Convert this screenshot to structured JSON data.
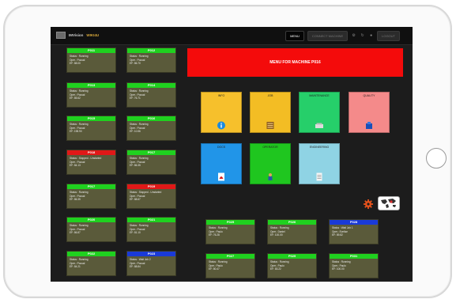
{
  "brand": {
    "name": "IMVision",
    "sub": "WIKI4U"
  },
  "nav": [
    {
      "label": "MENU",
      "active": true
    },
    {
      "label": "CONNECT MACHINE",
      "active": false
    },
    {
      "label": "LOGOUT",
      "active": false
    }
  ],
  "banner": "MENU FOR MACHINE P016",
  "machines_left": [
    {
      "name": "P011",
      "status": "Status : Running",
      "oper": "Oper.: Pousal",
      "ef": "EF: 88.00",
      "color": "green"
    },
    {
      "name": "P012",
      "status": "Status : Running",
      "oper": "Oper.: Pousal",
      "ef": "EF: 86.70",
      "color": "green"
    },
    {
      "name": "P013",
      "status": "Status : Running",
      "oper": "Oper.: Pousal",
      "ef": "EF: 85.62",
      "color": "green"
    },
    {
      "name": "P014",
      "status": "Status : Running",
      "oper": "Oper.: Pousal",
      "ef": "EF: 76.71",
      "color": "green"
    },
    {
      "name": "P015",
      "status": "Status : Running",
      "oper": "Oper.: Pousal",
      "ef": "EF: 198.90",
      "color": "green"
    },
    {
      "name": "P016",
      "status": "Status : Running",
      "oper": "Oper.: Pousal",
      "ef": "EF: 10.56",
      "color": "green"
    },
    {
      "name": "P018",
      "status": "Status : Stopped - Unstarted",
      "oper": "Oper.: Pousal",
      "ef": "EF: 84.13",
      "color": "red"
    },
    {
      "name": "P017",
      "status": "Status : Running",
      "oper": "Oper.: Pousal",
      "ef": "EF: 86.35",
      "color": "green"
    },
    {
      "name": "P017",
      "status": "Status : Running",
      "oper": "Oper.: Pousal",
      "ef": "EF: 86.35",
      "color": "green"
    },
    {
      "name": "P019",
      "status": "Status : Stopped - Unstarted",
      "oper": "Oper.: Pousal",
      "ef": "EF: 88.67",
      "color": "red"
    },
    {
      "name": "P020",
      "status": "Status : Running",
      "oper": "Oper.: Pousal",
      "ef": "EF: 86.87",
      "color": "green"
    },
    {
      "name": "P021",
      "status": "Status : Running",
      "oper": "Oper.: Pousal",
      "ef": "EF: 81.10",
      "color": "green"
    },
    {
      "name": "P022",
      "status": "Status : Running",
      "oper": "Oper.: Pousal",
      "ef": "EF: 84.21",
      "color": "green"
    },
    {
      "name": "P023",
      "status": "Status : Wait Job 2",
      "oper": "Oper.: Pousal",
      "ef": "EF: 88.84",
      "color": "blue"
    }
  ],
  "machines_bottom": [
    {
      "name": "P025",
      "status": "Status : Running",
      "oper": "Oper.: Paulo",
      "ef": "EF: 76.28",
      "color": "green"
    },
    {
      "name": "P026",
      "status": "Status : Running",
      "oper": "Oper.: Daniel",
      "ef": "EF: 100.00",
      "color": "green"
    },
    {
      "name": "P028",
      "status": "Status : Wait Job 1",
      "oper": "Oper.: Evelise",
      "ef": "EF: 89.82",
      "color": "blue"
    },
    {
      "name": "P027",
      "status": "Status : Running",
      "oper": "Oper.: Paulo",
      "ef": "EF: 80.47",
      "color": "green"
    },
    {
      "name": "P029",
      "status": "Status : Running",
      "oper": "Oper.: Paulo",
      "ef": "EF: 83.22",
      "color": "green"
    },
    {
      "name": "P031",
      "status": "Status : Running",
      "oper": "Oper.: Paulo",
      "ef": "EF: 100.00",
      "color": "green"
    }
  ],
  "tiles": [
    {
      "label": "INFO",
      "color": "#f6c02c",
      "icon": "info-icon"
    },
    {
      "label": "JOB",
      "color": "#f3bd24",
      "icon": "job-icon"
    },
    {
      "label": "MAINTENANCE",
      "color": "#26cf6a",
      "icon": "maintenance-icon"
    },
    {
      "label": "QUALITY",
      "color": "#f48a8a",
      "icon": "quality-icon"
    },
    {
      "label": "DOCS",
      "color": "#2195e8",
      "icon": "pdf-icon"
    },
    {
      "label": "OPERATOR",
      "color": "#1fc61f",
      "icon": "operator-icon"
    },
    {
      "label": "ENGINEERING",
      "color": "#8fd3e4",
      "icon": "document-icon"
    }
  ],
  "colors": {
    "green": "#1fd11f",
    "red": "#e01818",
    "blue": "#1a3ad8",
    "banner": "#f40b0b"
  }
}
